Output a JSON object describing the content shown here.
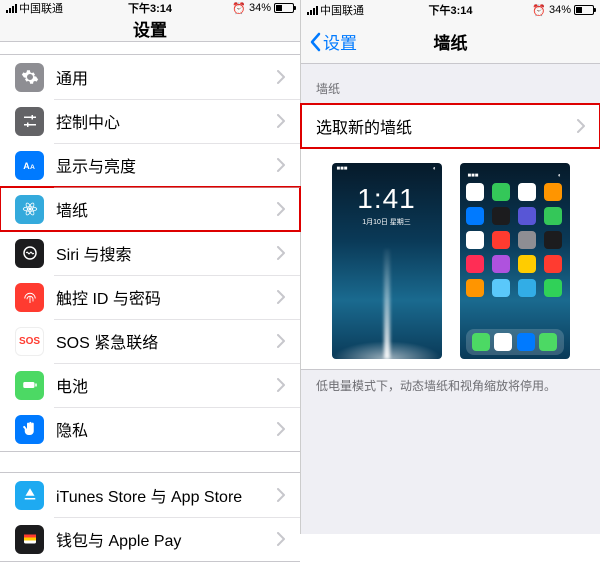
{
  "status": {
    "carrier": "中国联通",
    "time": "下午3:14",
    "battery_pct": "34%"
  },
  "left": {
    "title": "设置",
    "groups": [
      [
        {
          "id": "general",
          "label": "通用",
          "icon": "gear",
          "cls": "bg-gray"
        },
        {
          "id": "control",
          "label": "控制中心",
          "icon": "sliders",
          "cls": "bg-darkgray"
        },
        {
          "id": "display",
          "label": "显示与亮度",
          "icon": "aa",
          "cls": "bg-blue"
        },
        {
          "id": "wallpaper",
          "label": "墙纸",
          "icon": "flower",
          "cls": "bg-cyan",
          "highlight": true
        },
        {
          "id": "siri",
          "label": "Siri 与搜索",
          "icon": "siri",
          "cls": "bg-black"
        },
        {
          "id": "touchid",
          "label": "触控 ID 与密码",
          "icon": "fingerprint",
          "cls": "bg-red"
        },
        {
          "id": "sos",
          "label": "SOS 紧急联络",
          "icon": "sos",
          "cls": "bg-redtxt"
        },
        {
          "id": "battery",
          "label": "电池",
          "icon": "battery",
          "cls": "bg-green"
        },
        {
          "id": "privacy",
          "label": "隐私",
          "icon": "hand",
          "cls": "bg-blue"
        }
      ],
      [
        {
          "id": "itunes",
          "label": "iTunes Store 与 App Store",
          "icon": "appstore",
          "cls": "bg-store"
        },
        {
          "id": "wallet",
          "label": "钱包与 Apple Pay",
          "icon": "wallet",
          "cls": "bg-black"
        }
      ]
    ]
  },
  "right": {
    "back_label": "设置",
    "title": "墙纸",
    "section": "墙纸",
    "choose_label": "选取新的墙纸",
    "hint": "低电量模式下，动态墙纸和视角缩放将停用。",
    "lock": {
      "time": "1:41",
      "date": "1月10日 星期三"
    },
    "apps": [
      "#fff",
      "#34c759",
      "#fff",
      "#ff9500",
      "#007aff",
      "#1c1c1e",
      "#5856d6",
      "#34c759",
      "#fff",
      "#ff3b30",
      "#8e8e93",
      "#1c1c1e",
      "#ff2d55",
      "#af52de",
      "#ffcc00",
      "#ff3b30",
      "#ff9500",
      "#5ac8fa",
      "#32ade6",
      "#30d158"
    ],
    "dock": [
      "#4cd964",
      "#fff",
      "#007aff",
      "#4cd964"
    ]
  }
}
